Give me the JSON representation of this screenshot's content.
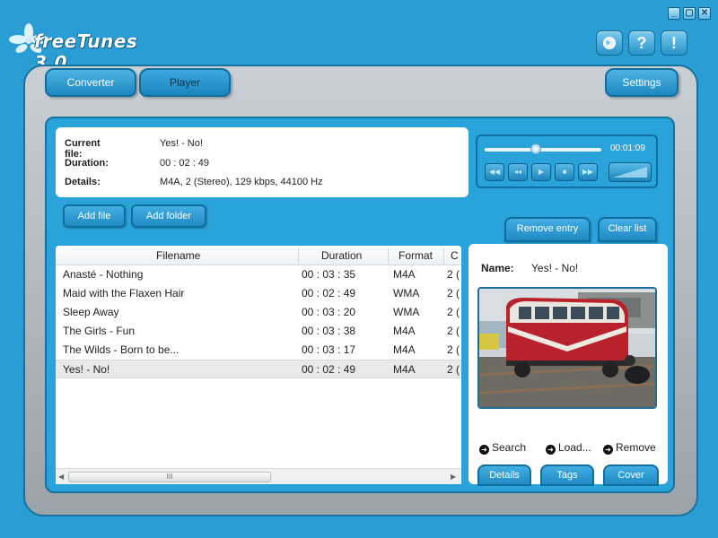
{
  "app": {
    "name": "freeTunes 3.0"
  },
  "window_controls": {
    "minimize": "_",
    "restore": "▢",
    "close": "✕"
  },
  "header_buttons": {
    "help_question": "?",
    "info": "!"
  },
  "tabs": {
    "converter": "Converter",
    "player": "Player",
    "settings": "Settings",
    "active": "Player"
  },
  "current": {
    "file_label": "Current file:",
    "file_value": "Yes! - No!",
    "duration_label": "Duration:",
    "duration_value": "00 : 02 : 49",
    "details_label": "Details:",
    "details_value": "M4A, 2 (Stereo), 129 kbps, 44100 Hz"
  },
  "player": {
    "time": "00:01:09",
    "progress_fraction": 0.44
  },
  "toolbar": {
    "add_file": "Add file",
    "add_folder": "Add folder",
    "remove_entry": "Remove entry",
    "clear_list": "Clear list"
  },
  "table": {
    "columns": [
      "Filename",
      "Duration",
      "Format",
      "C"
    ],
    "rows": [
      {
        "filename": "Anasté - Nothing",
        "duration": "00 : 03 : 35",
        "format": "M4A",
        "channels": "2 ("
      },
      {
        "filename": "Maid with the Flaxen Hair",
        "duration": "00 : 02 : 49",
        "format": "WMA",
        "channels": "2 ("
      },
      {
        "filename": "Sleep Away",
        "duration": "00 : 03 : 20",
        "format": "WMA",
        "channels": "2 ("
      },
      {
        "filename": "The Girls - Fun",
        "duration": "00 : 03 : 38",
        "format": "M4A",
        "channels": "2 ("
      },
      {
        "filename": "The Wilds - Born to be...",
        "duration": "00 : 03 : 17",
        "format": "M4A",
        "channels": "2 ("
      },
      {
        "filename": "Yes! - No!",
        "duration": "00 : 02 : 49",
        "format": "M4A",
        "channels": "2 ("
      }
    ],
    "selected_index": 5,
    "scroll_thumb": "III"
  },
  "detail": {
    "name_label": "Name:",
    "name_value": "Yes! - No!",
    "search": "Search",
    "load": "Load...",
    "remove": "Remove",
    "tab_details": "Details",
    "tab_tags": "Tags",
    "tab_cover": "Cover"
  }
}
